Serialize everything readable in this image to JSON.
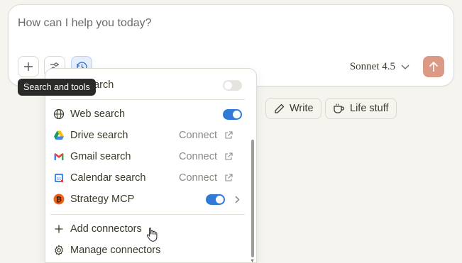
{
  "composer": {
    "placeholder": "How can I help you today?",
    "model": "Sonnet 4.5"
  },
  "tooltip": {
    "text": "Search and tools"
  },
  "chips": [
    {
      "icon": "pencil-icon",
      "label": "Write"
    },
    {
      "icon": "coffee-cup-icon",
      "label": "Life stuff"
    }
  ],
  "menu": {
    "partial_item": "earch",
    "items": [
      {
        "icon": "globe-icon",
        "label": "Web search",
        "state": "on"
      },
      {
        "icon": "google-drive-icon",
        "label": "Drive search",
        "action": "Connect"
      },
      {
        "icon": "gmail-icon",
        "label": "Gmail search",
        "action": "Connect"
      },
      {
        "icon": "google-calendar-icon",
        "label": "Calendar search",
        "action": "Connect"
      },
      {
        "icon": "bitcoin-icon",
        "label": "Strategy MCP",
        "state": "on"
      }
    ],
    "add_connectors": "Add connectors",
    "manage_connectors": "Manage connectors"
  },
  "colors": {
    "toggle_on": "#2f7ad6",
    "send_button": "#dc9a86",
    "background": "#f5f4ef"
  }
}
